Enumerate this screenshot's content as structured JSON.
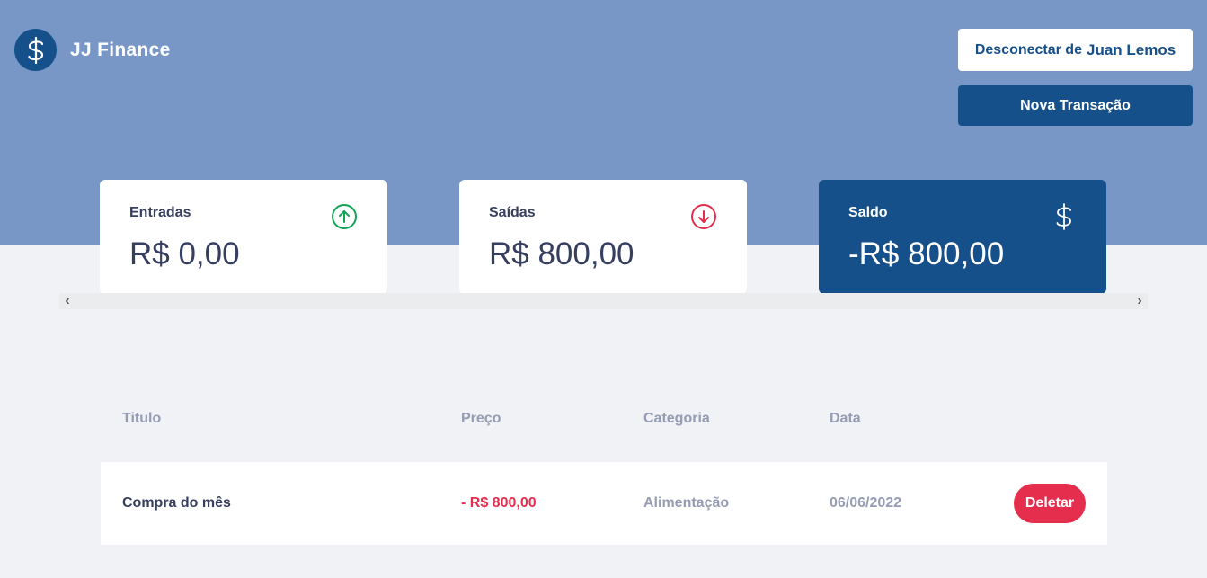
{
  "header": {
    "app_title": "JJ Finance",
    "disconnect_prefix": "Desconectar de",
    "user_name": "Juan Lemos",
    "new_transaction_label": "Nova Transação"
  },
  "summary": {
    "income": {
      "label": "Entradas",
      "value": "R$ 0,00"
    },
    "outcome": {
      "label": "Saídas",
      "value": "R$ 800,00"
    },
    "total": {
      "label": "Saldo",
      "value": "-R$ 800,00"
    }
  },
  "table": {
    "headers": [
      "Titulo",
      "Preço",
      "Categoria",
      "Data"
    ],
    "rows": [
      {
        "title": "Compra do mês",
        "price": "- R$ 800,00",
        "category": "Alimentação",
        "date": "06/06/2022",
        "action": "Deletar"
      }
    ]
  },
  "colors": {
    "hero": "#7896c6",
    "primary": "#16508a",
    "income_green": "#12a454",
    "outcome_red": "#e52e4d",
    "text": "#363f5f",
    "muted": "#969cb3",
    "background": "#f0f2f5"
  },
  "icons": {
    "logo": "dollar-icon",
    "income": "arrow-up-circle-icon",
    "outcome": "arrow-down-circle-icon",
    "total": "dollar-icon",
    "scroll_left": "chevron-left-icon",
    "scroll_right": "chevron-right-icon"
  }
}
